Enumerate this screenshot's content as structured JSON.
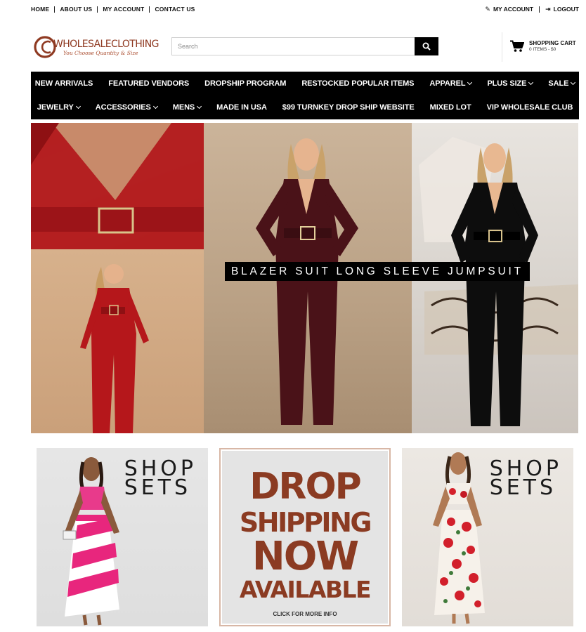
{
  "topbar": {
    "links": [
      "HOME",
      "ABOUT US",
      "MY ACCOUNT",
      "CONTACT US"
    ],
    "account": {
      "my_account": "MY ACCOUNT",
      "logout": "LOGOUT"
    }
  },
  "header": {
    "logo": {
      "brand": "WHOLESALECLOTHING",
      "tagline": "You Choose Quantity & Size"
    },
    "search": {
      "placeholder": "Search"
    },
    "cart": {
      "title": "SHOPPING CART",
      "summary": "0 ITEMS - $0"
    }
  },
  "nav": {
    "row1": [
      {
        "label": "NEW ARRIVALS",
        "dropdown": false
      },
      {
        "label": "FEATURED VENDORS",
        "dropdown": false
      },
      {
        "label": "DROPSHIP PROGRAM",
        "dropdown": false
      },
      {
        "label": "RESTOCKED POPULAR ITEMS",
        "dropdown": false
      },
      {
        "label": "APPAREL",
        "dropdown": true
      },
      {
        "label": "PLUS SIZE",
        "dropdown": true
      },
      {
        "label": "SALE",
        "dropdown": true
      }
    ],
    "row2": [
      {
        "label": "JEWELRY",
        "dropdown": true
      },
      {
        "label": "ACCESSORIES",
        "dropdown": true
      },
      {
        "label": "MENS",
        "dropdown": true
      },
      {
        "label": "MADE IN USA",
        "dropdown": false
      },
      {
        "label": "$99 TURNKEY DROP SHIP WEBSITE",
        "dropdown": false
      },
      {
        "label": "MIXED LOT",
        "dropdown": false
      },
      {
        "label": "VIP WHOLESALE CLUB",
        "dropdown": false
      }
    ]
  },
  "hero": {
    "banner": "BLAZER SUIT LONG SLEEVE JUMPSUIT"
  },
  "promos": {
    "left": {
      "line1": "SHOP",
      "line2": "SETS"
    },
    "center": {
      "line1": "DROP",
      "line2": "SHIPPING",
      "line3": "NOW",
      "line4": "AVAILABLE",
      "cta": "CLICK FOR MORE INFO"
    },
    "right": {
      "line1": "SHOP",
      "line2": "SETS"
    }
  },
  "colors": {
    "brand": "#8f3a22",
    "nav_bg": "#000000",
    "drop_text": "#8b3b22"
  }
}
